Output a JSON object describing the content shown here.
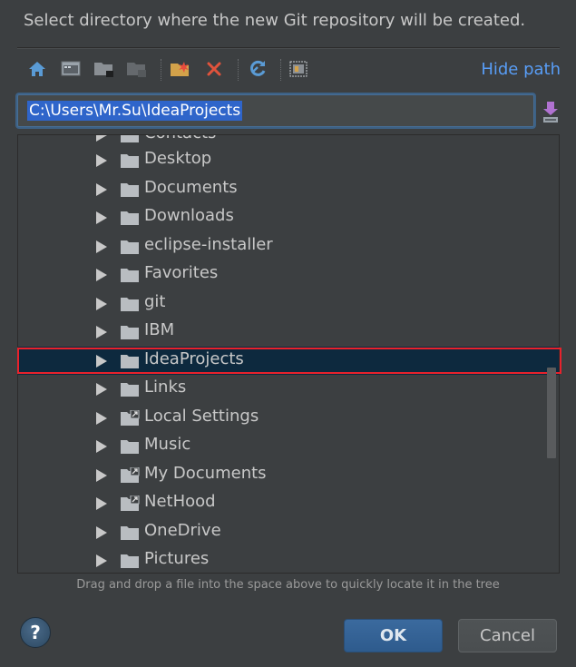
{
  "dialog": {
    "instruction": "Select directory where the new Git repository will be created.",
    "hint": "Drag and drop a file into the space above to quickly locate it in the tree"
  },
  "toolbar": {
    "buttons": [
      {
        "icon": "home-icon"
      },
      {
        "icon": "desktop-icon"
      },
      {
        "icon": "project-folder-icon"
      },
      {
        "icon": "module-folder-icon"
      },
      {
        "icon": "new-folder-icon"
      },
      {
        "icon": "delete-icon"
      },
      {
        "icon": "refresh-icon"
      },
      {
        "icon": "show-hidden-icon"
      }
    ],
    "hide_path_label": "Hide path"
  },
  "path": {
    "value": "C:\\Users\\Mr.Su\\IdeaProjects"
  },
  "tree": {
    "partial_row_label": "Contacts",
    "rows": [
      {
        "label": "Desktop",
        "linked": false,
        "selected": false
      },
      {
        "label": "Documents",
        "linked": false,
        "selected": false
      },
      {
        "label": "Downloads",
        "linked": false,
        "selected": false
      },
      {
        "label": "eclipse-installer",
        "linked": false,
        "selected": false
      },
      {
        "label": "Favorites",
        "linked": false,
        "selected": false
      },
      {
        "label": "git",
        "linked": false,
        "selected": false
      },
      {
        "label": "IBM",
        "linked": false,
        "selected": false
      },
      {
        "label": "IdeaProjects",
        "linked": false,
        "selected": true
      },
      {
        "label": "Links",
        "linked": false,
        "selected": false
      },
      {
        "label": "Local Settings",
        "linked": true,
        "selected": false
      },
      {
        "label": "Music",
        "linked": false,
        "selected": false
      },
      {
        "label": "My Documents",
        "linked": true,
        "selected": false
      },
      {
        "label": "NetHood",
        "linked": true,
        "selected": false
      },
      {
        "label": "OneDrive",
        "linked": false,
        "selected": false
      },
      {
        "label": "Pictures",
        "linked": false,
        "selected": false
      }
    ]
  },
  "buttons": {
    "help": "?",
    "ok": "OK",
    "cancel": "Cancel"
  },
  "colors": {
    "background": "#3c3f41",
    "selection": "#0d293e",
    "highlight_outline": "#e8222c",
    "link": "#589df6",
    "path_selection": "#2f65ca"
  }
}
